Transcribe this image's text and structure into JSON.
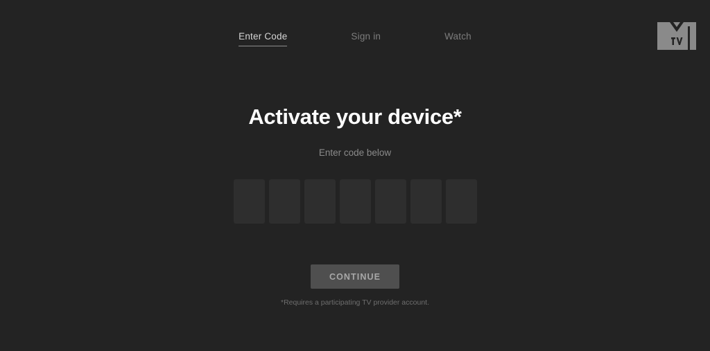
{
  "page": {
    "background_color": "#232323",
    "title": "Activate your device*",
    "subtitle": "Enter code below",
    "footnote": "*Requires a participating TV provider account."
  },
  "nav": {
    "items": [
      {
        "label": "Enter Code",
        "active": true
      },
      {
        "label": "Sign in",
        "active": false
      },
      {
        "label": "Watch",
        "active": false
      }
    ],
    "active_color": "#d6d6d6",
    "inactive_color": "#7d7d7d"
  },
  "brand": {
    "name": "mtv-logo",
    "logo_color": "#8a8a8a",
    "logo_mark_color": "#232323"
  },
  "code_entry": {
    "box_count": 7,
    "boxes": [
      {
        "value": "",
        "placeholder": ""
      },
      {
        "value": "",
        "placeholder": ""
      },
      {
        "value": "",
        "placeholder": ""
      },
      {
        "value": "",
        "placeholder": ""
      },
      {
        "value": "",
        "placeholder": ""
      },
      {
        "value": "",
        "placeholder": ""
      },
      {
        "value": "",
        "placeholder": ""
      }
    ],
    "box_color": "#2e2e2e"
  },
  "actions": {
    "continue_label": "CONTINUE",
    "continue_bg": "#4f4f4f",
    "continue_text_color": "#a8a8a8"
  }
}
